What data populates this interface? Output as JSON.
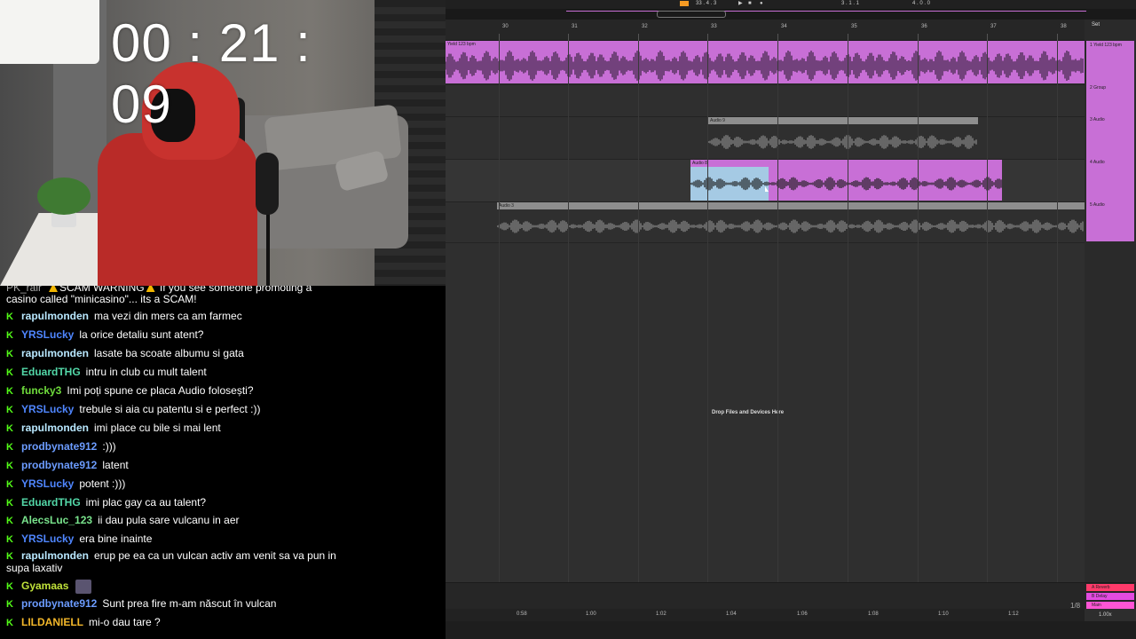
{
  "stream": {
    "timer": "00 : 21 : 09"
  },
  "chat": {
    "messages": [
      {
        "user": "PK_rair",
        "text": "SCAM WARNING",
        "text2": "If you see someone promoting a casino called \"minicasino\"... its a SCAM!",
        "color": "#aaaaaa"
      },
      {
        "user": "rapulmonden",
        "text": "ma vezi din mers ca am farmec",
        "color": "#b9e8ff"
      },
      {
        "user": "YRSLucky",
        "text": "la orice detaliu sunt atent?",
        "color": "#4f86ff"
      },
      {
        "user": "rapulmonden",
        "text": "lasate ba scoate albumu si gata",
        "color": "#b9e8ff"
      },
      {
        "user": "EduardTHG",
        "text": "intru in club cu mult talent",
        "color": "#53d8a8"
      },
      {
        "user": "funcky3",
        "text": "Imi poți spune ce placa Audio folosești?",
        "color": "#6fdc3c"
      },
      {
        "user": "YRSLucky",
        "text": "trebule si aia cu patentu si e perfect :))",
        "color": "#4f86ff"
      },
      {
        "user": "rapulmonden",
        "text": "imi place cu bile si mai lent",
        "color": "#b9e8ff"
      },
      {
        "user": "prodbynate912",
        "text": ":)))",
        "color": "#6c9cff"
      },
      {
        "user": "prodbynate912",
        "text": "latent",
        "color": "#6c9cff"
      },
      {
        "user": "YRSLucky",
        "text": "potent :)))",
        "color": "#4f86ff"
      },
      {
        "user": "EduardTHG",
        "text": "imi plac gay ca au talent?",
        "color": "#53d8a8"
      },
      {
        "user": "AlecsLuc_123",
        "text": "ii dau pula sare vulcanu in aer",
        "color": "#79e38c"
      },
      {
        "user": "YRSLucky",
        "text": "era bine inainte",
        "color": "#4f86ff"
      },
      {
        "user": "rapulmonden",
        "text": "erup pe ea ca un vulcan activ am venit sa va pun in",
        "text2": "supa laxativ",
        "color": "#b9e8ff"
      },
      {
        "user": "Gyamaas",
        "text": "",
        "color": "#c0e23a"
      },
      {
        "user": "prodbynate912",
        "text": "Sunt prea fire m-am născut în vulcan",
        "color": "#6c9cff"
      },
      {
        "user": "LILDANIELL",
        "text": "mi-o dau tare ?",
        "color": "#f3b72a"
      }
    ]
  },
  "daw": {
    "transport": {
      "position": "33 . 4 . 3",
      "loop": "3 . 1 . 1",
      "loop_len": "4 . 0 . 0"
    },
    "bars": [
      "30",
      "31",
      "32",
      "33",
      "34",
      "35",
      "36",
      "37",
      "38"
    ],
    "set_label": "Set",
    "tracks": [
      {
        "name": "1 Yield 123 bpm",
        "clip": "Yield 123 bpm"
      },
      {
        "name": "2 Group",
        "clip": ""
      },
      {
        "name": "3 Audio",
        "clip": "Audio 9"
      },
      {
        "name": "4 Audio",
        "clip": "Audio 8"
      },
      {
        "name": "5 Audio",
        "clip": "Audio 3"
      }
    ],
    "returns": [
      {
        "name": "A Reverb",
        "color": "#ff3a6a"
      },
      {
        "name": "B Delay",
        "color": "#e24be0"
      },
      {
        "name": "Main",
        "color": "#ff55d5"
      }
    ],
    "drop_text": "Drop Files and Devices Here",
    "timeline": [
      "0:58",
      "1:00",
      "1:02",
      "1:04",
      "1:06",
      "1:08",
      "1:10",
      "1:12"
    ],
    "grid_fraction": "1/8",
    "zoom": "1.00x",
    "colors": {
      "clip": "#c86fd6",
      "selection": "#9fdbe6",
      "inactive": "#9a9a9a"
    }
  }
}
